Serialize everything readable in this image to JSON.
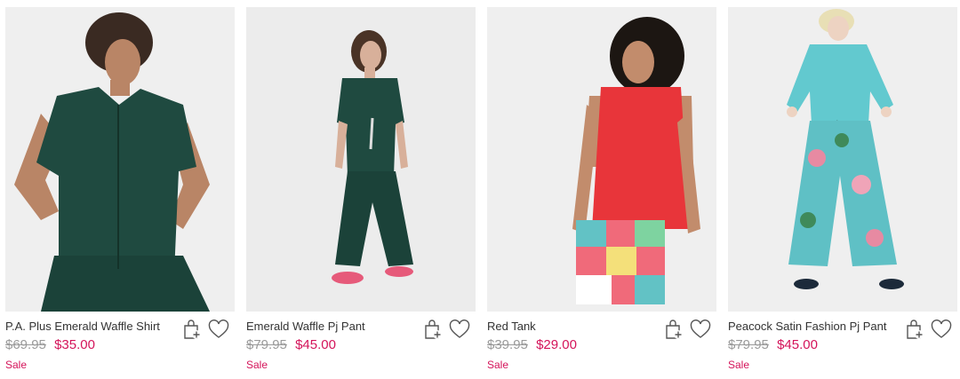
{
  "products": [
    {
      "name": "P.A. Plus Emerald Waffle Shirt",
      "was_price": "$69.95",
      "sale_price": "$35.00",
      "badge": "Sale",
      "image_desc": "woman in emerald green waffle shirt"
    },
    {
      "name": "Emerald Waffle Pj Pant",
      "was_price": "$79.95",
      "sale_price": "$45.00",
      "badge": "Sale",
      "image_desc": "woman in emerald green waffle pyjama set"
    },
    {
      "name": "Red Tank",
      "was_price": "$39.95",
      "sale_price": "$29.00",
      "badge": "Sale",
      "image_desc": "woman in red tank and patterned shorts"
    },
    {
      "name": "Peacock Satin Fashion Pj Pant",
      "was_price": "$79.95",
      "sale_price": "$45.00",
      "badge": "Sale",
      "image_desc": "woman in peacock print satin pj pant"
    }
  ],
  "colors": {
    "sale": "#d4145a",
    "was": "#9a9a9a",
    "text": "#333333",
    "emerald": "#1f4a40",
    "red": "#e8353a",
    "turquoise": "#62c2c5"
  },
  "icons": {
    "add_to_bag": "bag-plus-icon",
    "wishlist": "heart-icon"
  }
}
